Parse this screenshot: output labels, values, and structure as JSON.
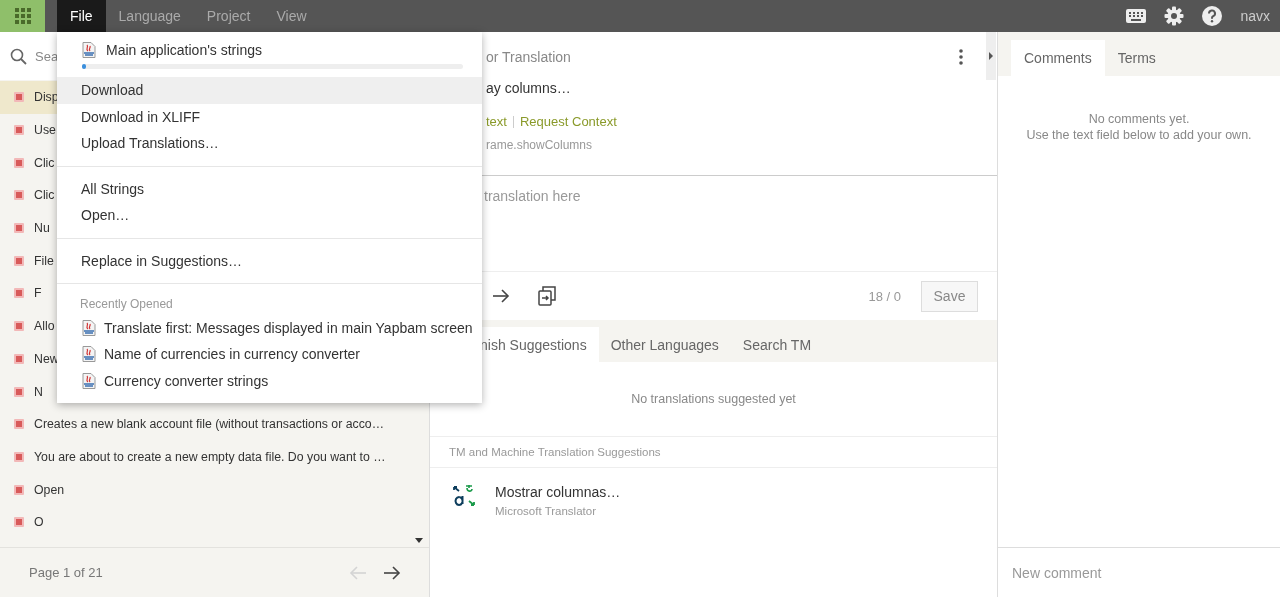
{
  "top_bar": {
    "menus": [
      {
        "label": "File",
        "selected": true
      },
      {
        "label": "Language",
        "selected": false
      },
      {
        "label": "Project",
        "selected": false
      },
      {
        "label": "View",
        "selected": false
      }
    ],
    "user": "navx"
  },
  "file_menu": {
    "project": {
      "name": "Main application's strings",
      "level": 0.01
    },
    "groups": [
      [
        {
          "label": "Download",
          "selected": true
        },
        {
          "label": "Download in XLIFF",
          "selected": false
        },
        {
          "label": "Upload Translations…",
          "selected": false
        }
      ],
      [
        {
          "label": "All Strings",
          "selected": false
        },
        {
          "label": "Open…",
          "selected": false
        }
      ],
      [
        {
          "label": "Replace in Suggestions…",
          "selected": false
        }
      ]
    ],
    "recent_heading": "Recently Opened",
    "recent": [
      "Translate first: Messages displayed in main Yapbam screen",
      "Name of currencies in currency converter",
      "Currency converter strings"
    ]
  },
  "search": {
    "placeholder": "Sea"
  },
  "strings": [
    {
      "text": "Disp",
      "selected": true
    },
    {
      "text": "Use",
      "selected": false
    },
    {
      "text": "Clic",
      "selected": false
    },
    {
      "text": "Clic",
      "selected": false
    },
    {
      "text": "Nu",
      "selected": false
    },
    {
      "text": "File",
      "selected": false
    },
    {
      "text": "F",
      "selected": false
    },
    {
      "text": "Allo",
      "selected": false
    },
    {
      "text": "New",
      "selected": false
    },
    {
      "text": "N",
      "selected": false
    },
    {
      "text": "Creates a new blank account file (without transactions or acco…",
      "selected": false
    },
    {
      "text": "You are about to create a new empty data file. Do you want to …",
      "selected": false
    },
    {
      "text": "Open",
      "selected": false
    },
    {
      "text": "O",
      "selected": false
    }
  ],
  "pagination": {
    "label": "Page 1 of 21",
    "prev_disabled": true
  },
  "source": {
    "title": "or Translation",
    "text": "ay columns…",
    "context_links": [
      "text",
      "Request Context"
    ],
    "key": "rame.showColumns"
  },
  "editor": {
    "placeholder": "translation here",
    "counter": "18 / 0",
    "save": "Save"
  },
  "suggestion_tabs": [
    {
      "label": "nish Suggestions",
      "selected": true
    },
    {
      "label": "Other Languages",
      "selected": false
    },
    {
      "label": "Search TM",
      "selected": false
    }
  ],
  "no_suggestions": "No translations suggested yet",
  "tm_heading": "TM and Machine Translation Suggestions",
  "tm_results": [
    {
      "text": "Mostrar columnas…",
      "source": "Microsoft Translator"
    }
  ],
  "side_tabs": [
    {
      "label": "Comments",
      "selected": true
    },
    {
      "label": "Terms",
      "selected": false
    }
  ],
  "comments_empty": [
    "No comments yet.",
    "Use the text field below to add your own."
  ],
  "comment_field": {
    "placeholder": "New comment"
  }
}
